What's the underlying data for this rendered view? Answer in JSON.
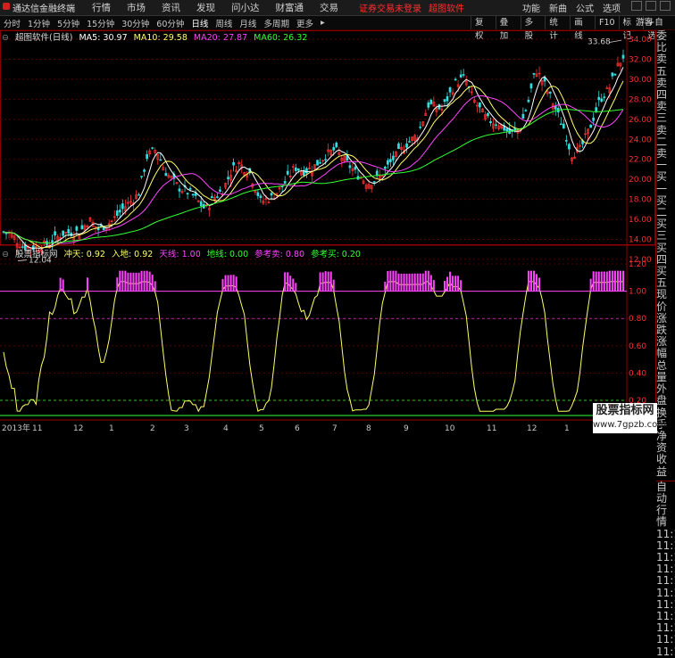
{
  "menu": {
    "app_title": "通达信金融终端",
    "items": [
      "行情",
      "市场",
      "资讯",
      "发现",
      "问小达",
      "财富通",
      "交易"
    ],
    "trade_warning": "证券交易未登录",
    "brand_link": "超图软件",
    "right_items": [
      "功能",
      "新曲",
      "公式",
      "选项"
    ]
  },
  "toolbar": {
    "periods": [
      "分时",
      "1分钟",
      "5分钟",
      "15分钟",
      "30分钟",
      "60分钟",
      "日线",
      "周线",
      "月线",
      "多周期",
      "更多"
    ],
    "active_period": "日线",
    "right_tools": [
      "复权",
      "叠加",
      "多股",
      "统计",
      "画线",
      "F10",
      "标记",
      "+自选"
    ],
    "guest_label": "游客"
  },
  "main_chart": {
    "stock_label": "超图软件(日线)",
    "ma": [
      {
        "label": "MA5: 30.97",
        "color": "#ffffff"
      },
      {
        "label": "MA10: 29.58",
        "color": "#ffff66"
      },
      {
        "label": "MA20: 27.87",
        "color": "#ff44ff"
      },
      {
        "label": "MA60: 26.32",
        "color": "#33ff33"
      }
    ],
    "y_ticks": [
      "34.00",
      "32.00",
      "30.00",
      "28.00",
      "26.00",
      "24.00",
      "22.00",
      "20.00",
      "18.00",
      "16.00",
      "14.00",
      "12.00"
    ],
    "high_label": "33.68",
    "low_label": "12.04"
  },
  "indicator": {
    "name": "股票指标网",
    "values": [
      {
        "label": "冲天: 0.92",
        "color": "#ffff66"
      },
      {
        "label": "入地: 0.92",
        "color": "#ffff66"
      },
      {
        "label": "天线: 1.00",
        "color": "#ff44ff"
      },
      {
        "label": "地线: 0.00",
        "color": "#33ff33"
      },
      {
        "label": "参考卖: 0.80",
        "color": "#ff44ff"
      },
      {
        "label": "参考买: 0.20",
        "color": "#33ff33"
      }
    ],
    "y_ticks": [
      "1.20",
      "1.00",
      "0.80",
      "0.60",
      "0.40",
      "0.20"
    ]
  },
  "x_axis": {
    "labels": [
      "2013年",
      "11",
      "12",
      "1",
      "2",
      "3",
      "4",
      "5",
      "6",
      "7",
      "8",
      "9",
      "10",
      "11",
      "12",
      "1"
    ]
  },
  "right_panel": {
    "upper": [
      "委比",
      "卖五",
      "卖四",
      "卖三",
      "卖二",
      "卖一",
      "买一",
      "买二",
      "买三",
      "买四",
      "买五",
      "现价",
      "涨跌",
      "涨幅",
      "总量",
      "外盘",
      "换手",
      "净资",
      "收益"
    ],
    "lower": [
      "自动",
      "行情",
      "11:1",
      "11:1",
      "11:1",
      "11:1",
      "11:1",
      "11:1",
      "11:1",
      "11:1",
      "11:1",
      "11:1",
      "11:1"
    ]
  },
  "watermark": {
    "line1": "股票指标网",
    "line2": "www.7gpzb.com"
  }
}
